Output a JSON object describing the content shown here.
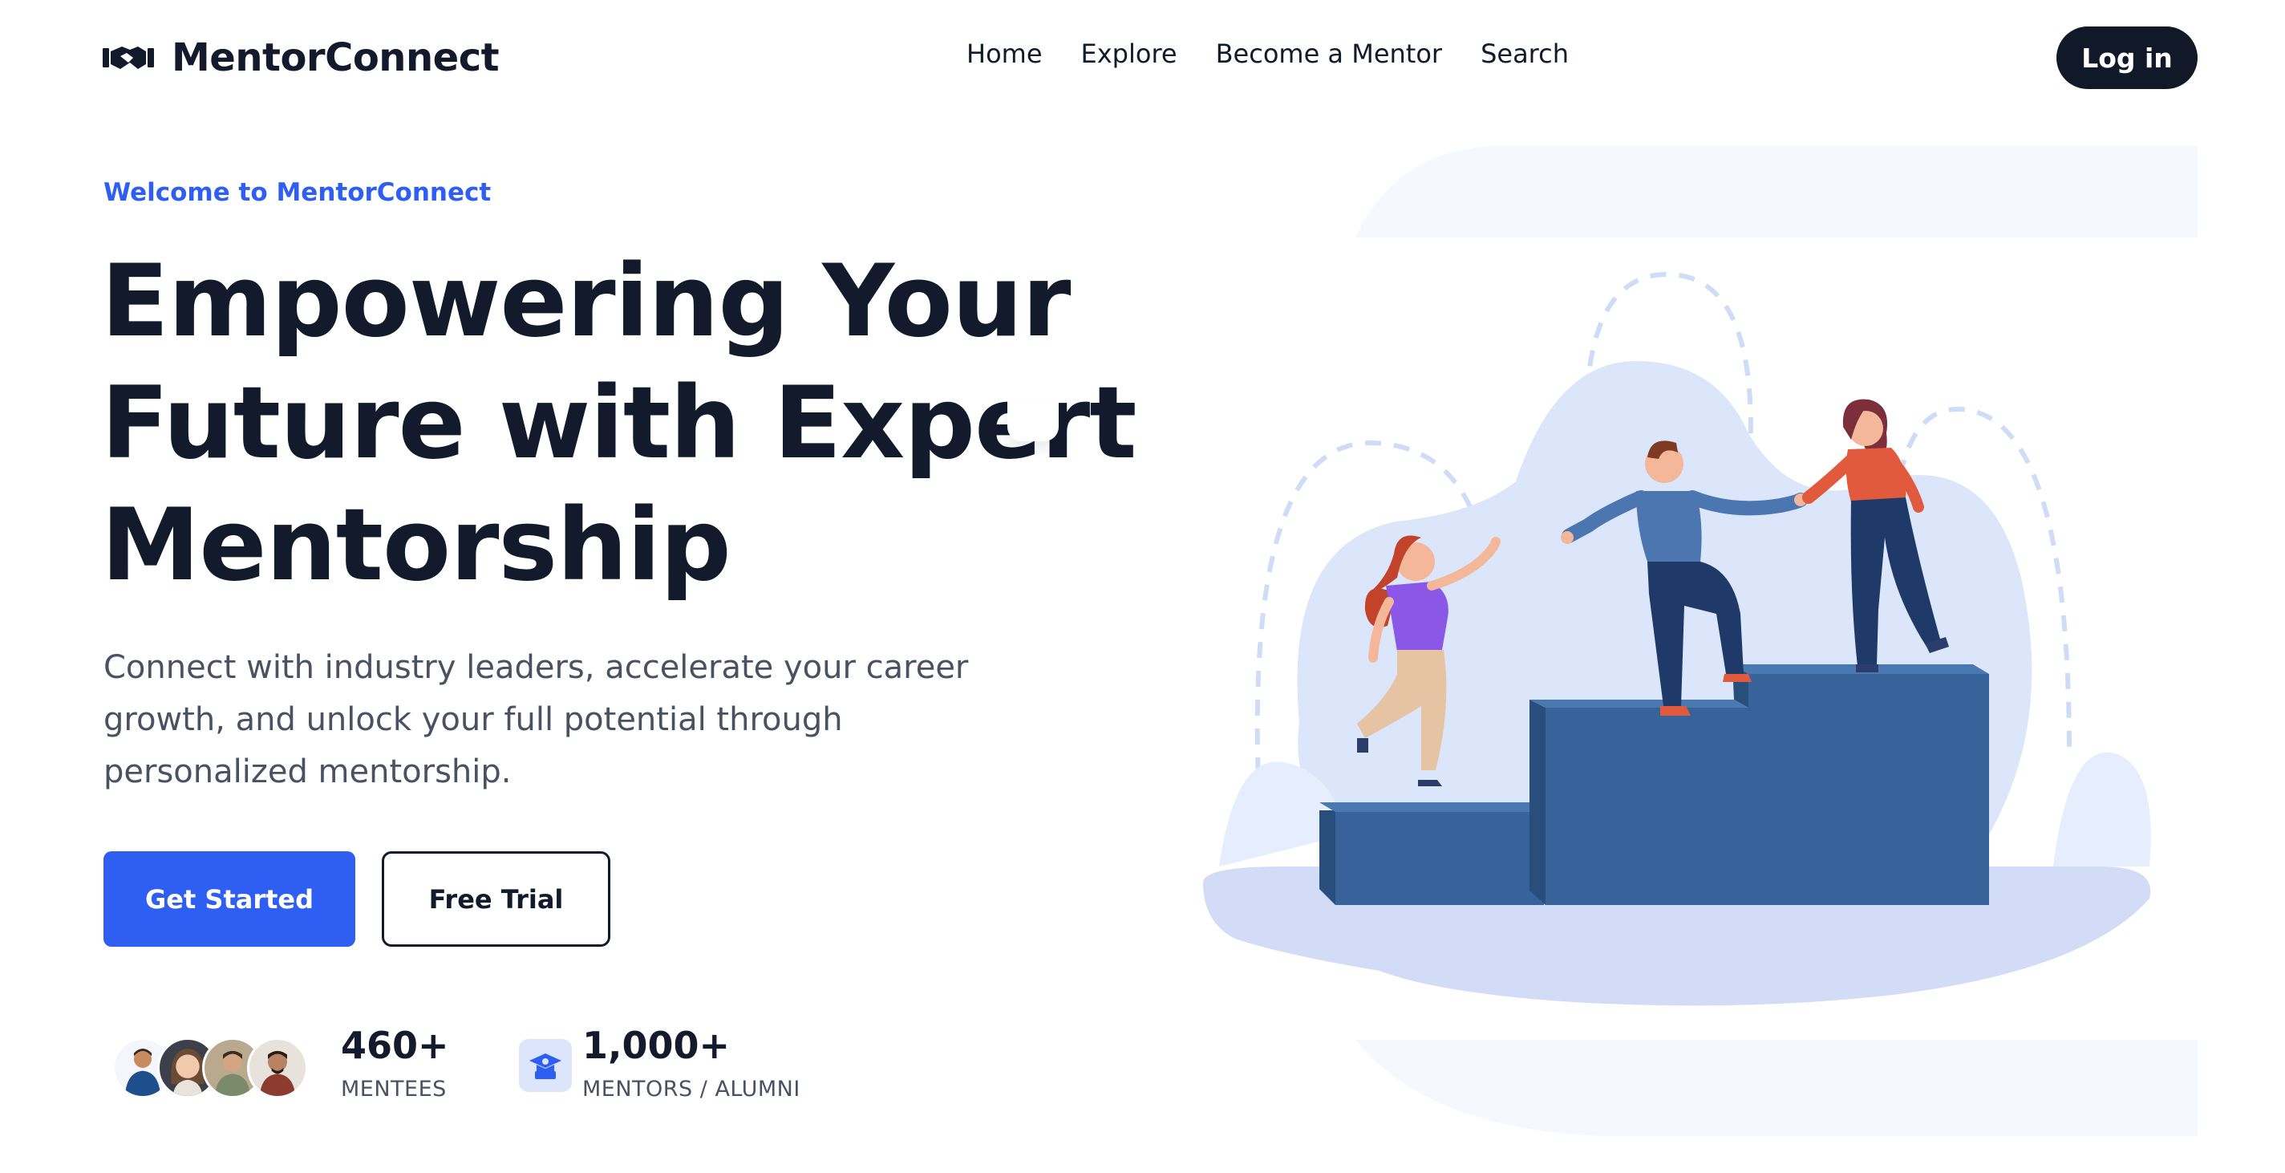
{
  "brand": {
    "name": "MentorConnect",
    "logo_icon": "handshake-icon"
  },
  "nav": {
    "links": [
      "Home",
      "Explore",
      "Become a Mentor",
      "Search"
    ],
    "login_label": "Log in"
  },
  "hero": {
    "eyebrow": "Welcome to MentorConnect",
    "headline": [
      "Empowering Your",
      "Future with Expert",
      "Mentorship"
    ],
    "subtitle": [
      "Connect with industry leaders, accelerate your career",
      "growth, and unlock your full potential through",
      "personalized mentorship."
    ],
    "primary_cta": "Get Started",
    "secondary_cta": "Free Trial",
    "illustration_icon": "mentorship-stairs-illustration"
  },
  "stats": [
    {
      "value": "460+",
      "label": "MENTEES",
      "icon": "mentee-avatars"
    },
    {
      "value": "1,000+",
      "label": "MENTORS / ALUMNI",
      "icon": "graduation-cap-icon"
    }
  ],
  "colors": {
    "accent": "#2f5ff2",
    "dark": "#111827",
    "text": "#121a2c",
    "muted": "#4a5162",
    "illustration_blue": "#37639a",
    "illustration_light": "#dbe6fb"
  }
}
